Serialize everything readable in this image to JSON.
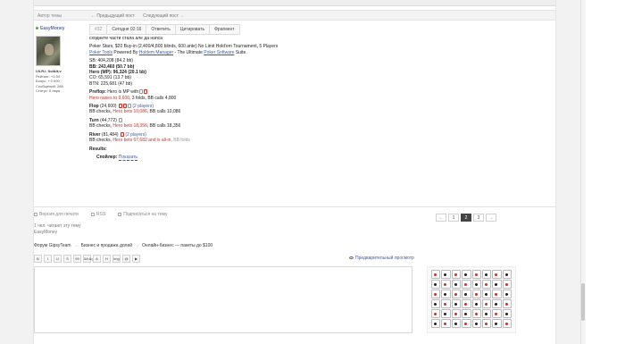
{
  "post": {
    "author_label": "Автор темы",
    "prev_label": "← Предыдущий пост",
    "next_label": "Следующий пост →",
    "username": "EasyMoney",
    "tabs": [
      "#32",
      "Сегодня 02:16",
      "Ответить",
      "Цитировать",
      "Фрагмент"
    ],
    "user_stats": {
      "name": "I.N.R.I. Sol&lt;v",
      "rating": "Рейтинг: +3.54",
      "bonus": "Бонус: + 0 000",
      "posts": "Сообщений: 268",
      "status": "Статус: 0 ларя"
    },
    "intro": "сходните части стала але да напса",
    "meta_line1": "Poker Stars, $20 Buy-in (2,400/4,800 blinds, 600 ante) No Limit Hold'em Tournament, 5 Players",
    "meta_link1": "Poker Tools",
    "meta_mid": " Powered By ",
    "meta_link2": "Holdem Manager",
    "meta_mid2": " - The Ultimate ",
    "meta_link3": "Poker Software",
    "meta_end": " Suite.",
    "stacks": [
      {
        "text": "SB: 404,208 (84.2 bb)",
        "bold": false
      },
      {
        "text": "BB: 243,460 (50.7 bb)",
        "bold": true
      },
      {
        "text": "Hero (MP): 96,324 (20.1 bb)",
        "bold": true
      },
      {
        "text": "CO: 65,591 (13.7 bb)",
        "bold": false
      },
      {
        "text": "BTN: 225,681 (47 bb)",
        "bold": false
      }
    ],
    "preflop_label": "Preflop:",
    "preflop_text": " Hero is MP with",
    "preflop_action_red": "Hero raises to 9,600",
    "preflop_action_rest": ", 3 folds, BB calls 4,800",
    "flop_label": "Flop",
    "flop_pot": " (24,600) ",
    "flop_players": "(2 players)",
    "flop_line2a": "BB checks, ",
    "flop_line2red": "Hero bets 10,086",
    "flop_line2b": ", BB calls 10,086",
    "turn_label": "Turn",
    "turn_pot": " (44,772) ",
    "turn_line2a": "BB checks, ",
    "turn_line2red": "Hero bets 18,356",
    "turn_line2b": ", BB calls 18,356",
    "river_label": "River",
    "river_pot": " (81,484) ",
    "river_players": "(2 players)",
    "river_line2a": "BB checks, ",
    "river_line2red": "Hero bets 67,682 and is all-in",
    "river_line2b": ", BB folds",
    "results_label": "Results:",
    "spoiler_label": "Спойлер:",
    "spoiler_button": "Показать"
  },
  "options": {
    "print": "Версия для печати",
    "rss": "RSS",
    "subscribe": "Подписаться на тему"
  },
  "pager": [
    "←",
    "1",
    "2",
    "3",
    "→"
  ],
  "reading": {
    "line1": "1 чел. читают эту тему",
    "line2": "EasyMoney"
  },
  "breadcrumbs": [
    "Форум GipsyTeam",
    "Бизнес и продажа долей",
    "Онлайн-бизнес — пакеты до $100"
  ],
  "preview_label": "Предварительный просмотр",
  "toolbar": [
    "B",
    "I",
    "U",
    "S",
    "99",
    "&lt;&gt;",
    "A",
    "H",
    "img",
    "@",
    "▶"
  ],
  "card_colors": [
    "red",
    "blk",
    "red",
    "blk",
    "red",
    "blk",
    "red",
    "blk",
    "blk",
    "red",
    "blk",
    "red",
    "blk",
    "red",
    "blk",
    "red",
    "red",
    "blk",
    "red",
    "blk",
    "red",
    "blk",
    "red",
    "blk",
    "blk",
    "red",
    "blk",
    "red",
    "blk",
    "red",
    "blk",
    "red",
    "red",
    "blk",
    "red",
    "blk",
    "red",
    "blk",
    "red",
    "blk",
    "blk",
    "red",
    "blk",
    "red",
    "blk",
    "red",
    "blk",
    "red"
  ]
}
